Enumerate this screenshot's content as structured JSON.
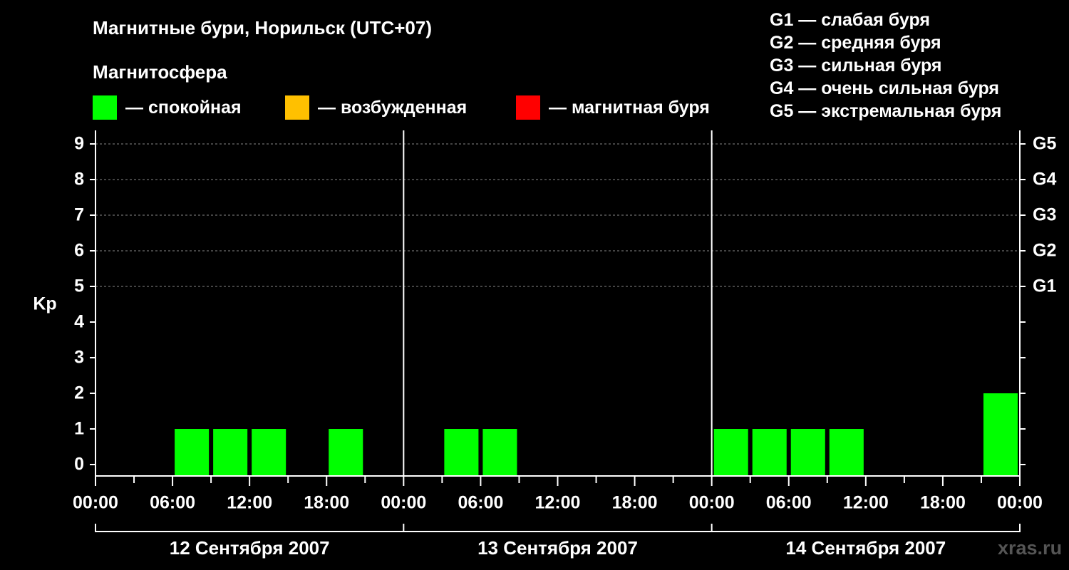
{
  "chart_data": {
    "type": "bar",
    "title": "Магнитные бури, Норильск (UTC+07)",
    "subtitle": "Магнитосфера",
    "ylabel": "Kp",
    "ylim": [
      0,
      9
    ],
    "yticks": [
      "0",
      "1",
      "2",
      "3",
      "4",
      "5",
      "6",
      "7",
      "8",
      "9"
    ],
    "g_levels": [
      {
        "kp": 5,
        "label": "G1"
      },
      {
        "kp": 6,
        "label": "G2"
      },
      {
        "kp": 7,
        "label": "G3"
      },
      {
        "kp": 8,
        "label": "G4"
      },
      {
        "kp": 9,
        "label": "G5"
      }
    ],
    "grid": true,
    "legend_position": "top",
    "legend": [
      {
        "color": "#00ff00",
        "label": "— спокойная"
      },
      {
        "color": "#ffc000",
        "label": "— возбужденная"
      },
      {
        "color": "#ff0000",
        "label": "— магнитная буря"
      }
    ],
    "g_scale_legend": [
      "G1 — слабая буря",
      "G2 — средняя буря",
      "G3 — сильная буря",
      "G4 — очень сильная буря",
      "G5 — экстремальная буря"
    ],
    "x_tick_labels": [
      "00:00",
      "06:00",
      "12:00",
      "18:00",
      "00:00",
      "06:00",
      "12:00",
      "18:00",
      "00:00",
      "06:00",
      "12:00",
      "18:00",
      "00:00"
    ],
    "days": [
      "12 Сентября 2007",
      "13 Сентября 2007",
      "14 Сентября 2007"
    ],
    "interval_hours": 3,
    "series": [
      {
        "values": [
          0,
          0,
          1,
          1,
          1,
          0,
          1,
          0,
          0,
          1,
          1,
          0,
          0,
          0,
          0,
          0,
          1,
          1,
          1,
          1,
          0,
          0,
          0,
          2
        ],
        "color": "#00ff00"
      }
    ]
  },
  "watermark": "xras.ru"
}
